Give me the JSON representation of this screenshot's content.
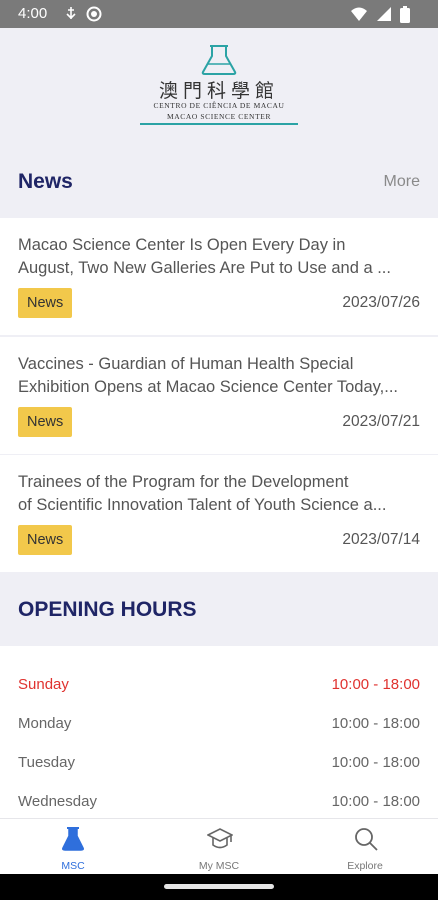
{
  "status_bar": {
    "time": "4:00"
  },
  "logo": {
    "chinese": "澳門科學館",
    "portuguese": "CENTRO DE CIÊNCIA DE MACAU",
    "english": "MACAO SCIENCE CENTER",
    "accent_color": "#2ba3a5"
  },
  "news": {
    "title": "News",
    "more_label": "More",
    "items": [
      {
        "title_line1": "Macao Science Center Is Open Every Day in",
        "title_line2": "August, Two New Galleries Are Put to Use and a ...",
        "badge": "News",
        "date": "2023/07/26"
      },
      {
        "title_line1": "Vaccines - Guardian of Human Health Special",
        "title_line2": "Exhibition Opens at Macao Science Center Today,...",
        "badge": "News",
        "date": "2023/07/21"
      },
      {
        "title_line1": "Trainees of the Program for the Development",
        "title_line2": "of Scientific Innovation Talent of Youth Science a...",
        "badge": "News",
        "date": "2023/07/14"
      }
    ]
  },
  "opening_hours": {
    "title": "OPENING HOURS",
    "days": [
      {
        "day": "Sunday",
        "hours": "10:00 - 18:00"
      },
      {
        "day": "Monday",
        "hours": "10:00 - 18:00"
      },
      {
        "day": "Tuesday",
        "hours": "10:00 - 18:00"
      },
      {
        "day": "Wednesday",
        "hours": "10:00 - 18:00"
      }
    ],
    "highlight_color": "#e0322f"
  },
  "bottom_nav": {
    "items": [
      {
        "label": "MSC",
        "icon": "flask-icon",
        "active": true
      },
      {
        "label": "My MSC",
        "icon": "graduation-cap-icon",
        "active": false
      },
      {
        "label": "Explore",
        "icon": "search-icon",
        "active": false
      }
    ],
    "active_color": "#2f6fdc"
  }
}
